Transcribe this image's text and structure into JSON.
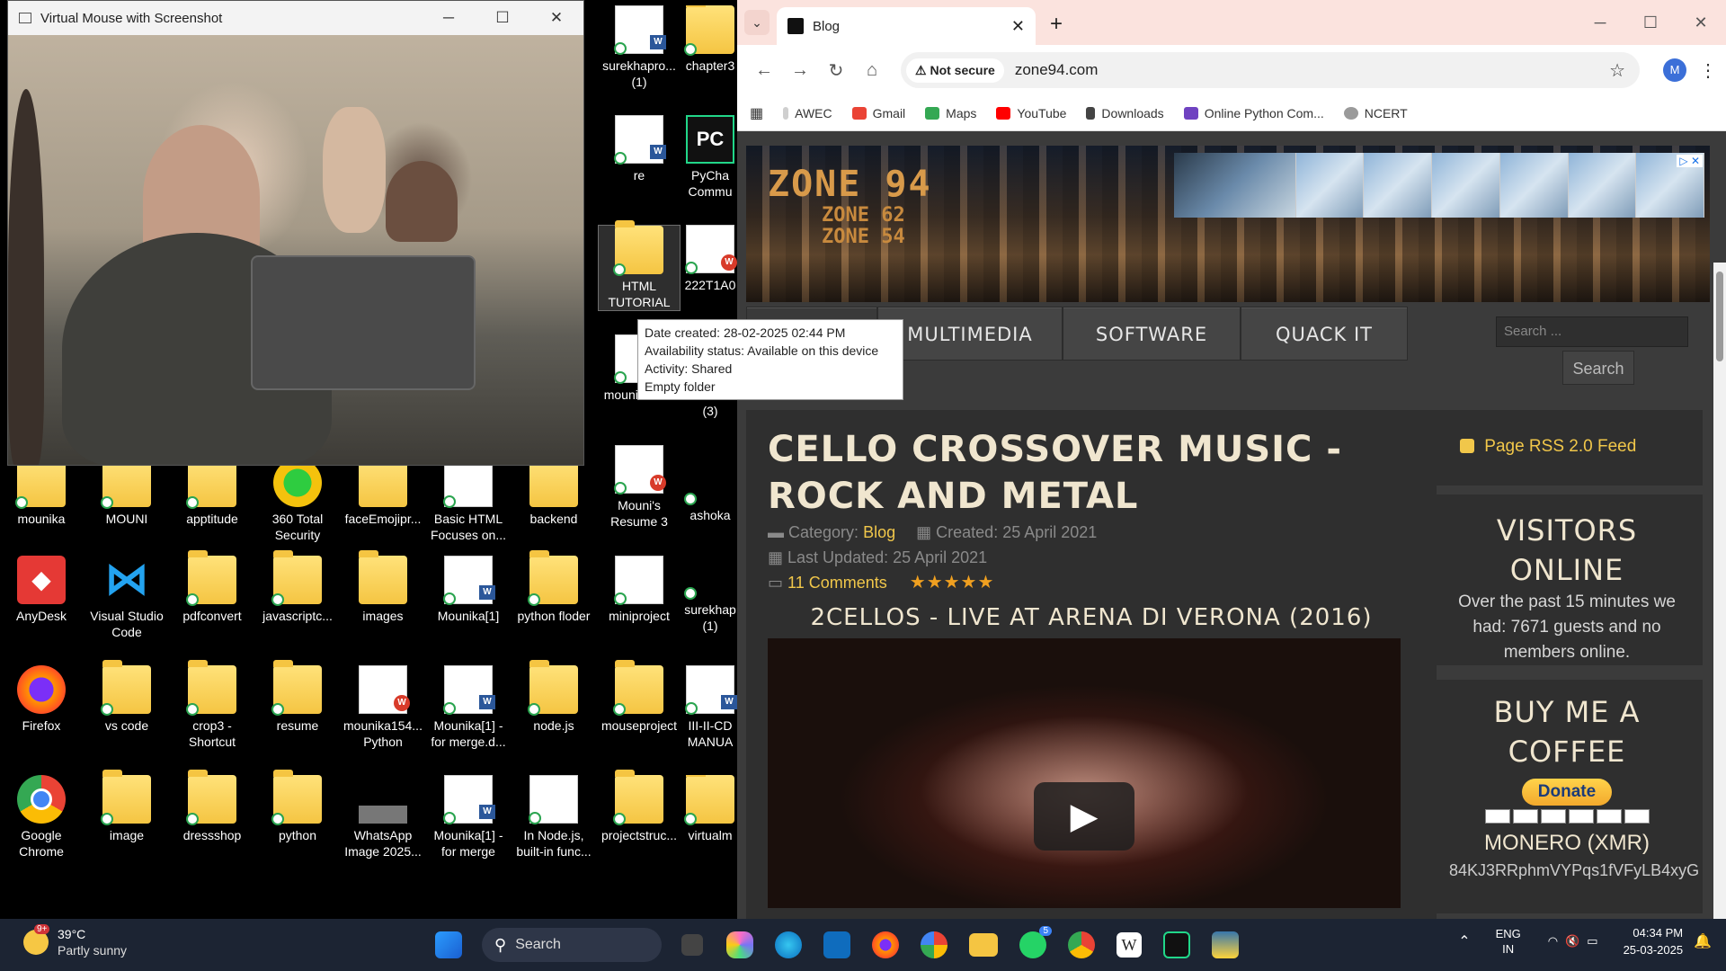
{
  "vm_window": {
    "title": "Virtual Mouse with Screenshot"
  },
  "tooltip": {
    "lines": [
      "Date created: 28-02-2025 02:44 PM",
      "Availability status: Available on this device",
      "Activity: Shared",
      "Empty folder"
    ]
  },
  "desktop": {
    "icons": [
      {
        "label": "surekhapro...\n(1)",
        "type": "docw"
      },
      {
        "label": "chapter3",
        "type": "folder"
      },
      {
        "label": "re",
        "type": "docw"
      },
      {
        "label": "PyCha\nCommu",
        "type": "app"
      },
      {
        "label": "HTML\nTUTORIAL",
        "type": "folder"
      },
      {
        "label": "222T1A0",
        "type": "doc"
      },
      {
        "label": "mounikafix...",
        "type": "doc"
      },
      {
        "label": "New fo\n(3)",
        "type": "folder"
      },
      {
        "label": "mounika",
        "type": "folder"
      },
      {
        "label": "MOUNI",
        "type": "folder"
      },
      {
        "label": "apptitude",
        "type": "folder"
      },
      {
        "label": "360 Total\nSecurity",
        "type": "app"
      },
      {
        "label": "faceEmojipr...",
        "type": "folder"
      },
      {
        "label": "Basic HTML\nFocuses on...",
        "type": "doc"
      },
      {
        "label": "backend",
        "type": "folder"
      },
      {
        "label": "Mouni's\nResume 3",
        "type": "docwps"
      },
      {
        "label": "ashoka",
        "type": "doc"
      },
      {
        "label": "AnyDesk",
        "type": "app"
      },
      {
        "label": "Visual Studio\nCode",
        "type": "app"
      },
      {
        "label": "pdfconvert",
        "type": "folder"
      },
      {
        "label": "javascriptc...",
        "type": "folder"
      },
      {
        "label": "images",
        "type": "folder"
      },
      {
        "label": "Mounika[1]",
        "type": "docw"
      },
      {
        "label": "python floder",
        "type": "folder"
      },
      {
        "label": "miniproject",
        "type": "doc"
      },
      {
        "label": "surekhap\n(1)",
        "type": "folder"
      },
      {
        "label": "Firefox",
        "type": "app"
      },
      {
        "label": "vs code",
        "type": "folder"
      },
      {
        "label": "crop3 -\nShortcut",
        "type": "folder"
      },
      {
        "label": "resume",
        "type": "folder"
      },
      {
        "label": "mounika154...\nPython",
        "type": "docwps"
      },
      {
        "label": "Mounika[1] -\nfor merge.d...",
        "type": "docw"
      },
      {
        "label": "node.js",
        "type": "folder"
      },
      {
        "label": "mouseproject",
        "type": "folder"
      },
      {
        "label": "III-II-CD\nMANUA",
        "type": "docw"
      },
      {
        "label": "Google\nChrome",
        "type": "app"
      },
      {
        "label": "image",
        "type": "folder"
      },
      {
        "label": "dressshop",
        "type": "folder"
      },
      {
        "label": "python",
        "type": "folder"
      },
      {
        "label": "WhatsApp\nImage 2025...",
        "type": "img"
      },
      {
        "label": "Mounika[1] -\nfor merge",
        "type": "docw"
      },
      {
        "label": "In Node.js,\nbuilt-in func...",
        "type": "doc"
      },
      {
        "label": "projectstruc...",
        "type": "folder"
      },
      {
        "label": "virtualm",
        "type": "folder"
      }
    ]
  },
  "browser": {
    "tab": {
      "title": "Blog"
    },
    "omnibox": {
      "security": "Not secure",
      "url": "zone94.com"
    },
    "profile_initial": "M",
    "bookmarks": [
      "AWEC",
      "Gmail",
      "Maps",
      "YouTube",
      "Downloads",
      "Online Python Com...",
      "NCERT"
    ],
    "bookmark_colors": [
      "#cfcfcf",
      "#ea4335",
      "#34a853",
      "#ff0000",
      "#444444",
      "#6f42c1",
      "#9a9a9a"
    ]
  },
  "site": {
    "logo": {
      "line1": "ZONE 94",
      "line2": "ZONE 62",
      "line3": "ZONE 54"
    },
    "nav": [
      "MULTIMEDIA",
      "SOFTWARE",
      "QUACK IT"
    ],
    "search": {
      "placeholder": "Search ...",
      "button": "Search"
    },
    "article": {
      "title": "CELLO CROSSOVER MUSIC - ROCK AND METAL",
      "category_label": "Category:",
      "category": "Blog",
      "created": "Created: 25 April 2021",
      "updated": "Last Updated: 25 April 2021",
      "comments": "11 Comments",
      "rating": "★★★★★",
      "video_title": "2CELLOS - LIVE AT ARENA DI VERONA (2016)"
    },
    "rss": "Page RSS 2.0 Feed",
    "visitors": {
      "heading": "VISITORS ONLINE",
      "text": "Over the past 15 minutes we had: 7671 guests and no members online."
    },
    "coffee": {
      "heading": "BUY ME A COFFEE",
      "donate": "Donate",
      "monero": "MONERO (XMR)",
      "address": "84KJ3RRphmVYPqs1fVFyLB4xyG"
    }
  },
  "taskbar": {
    "weather": {
      "temp": "39°C",
      "desc": "Partly sunny",
      "badge": "9+"
    },
    "search_label": "Search",
    "lang": {
      "line1": "ENG",
      "line2": "IN"
    },
    "time": "04:34 PM",
    "date": "25-03-2025",
    "whatsapp_badge": "5"
  }
}
